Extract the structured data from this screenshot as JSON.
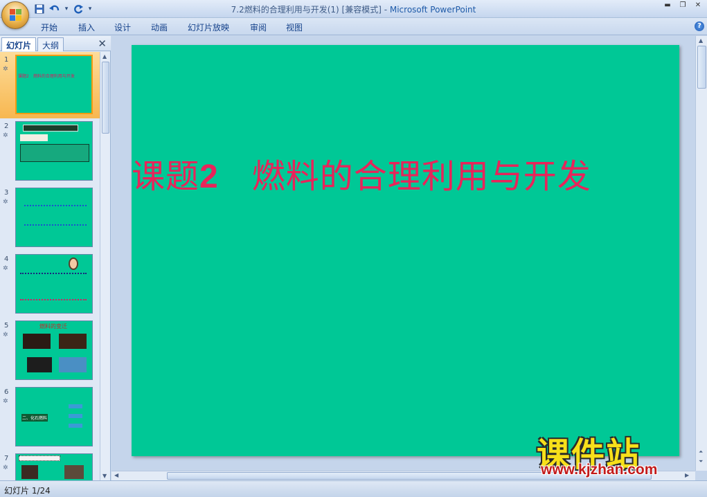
{
  "window": {
    "title": "7.2燃料的合理利用与开发(1) [兼容模式] - ",
    "app_name": "Microsoft PowerPoint"
  },
  "ribbon": {
    "tabs": [
      "开始",
      "插入",
      "设计",
      "动画",
      "幻灯片放映",
      "审阅",
      "视图"
    ]
  },
  "left_pane": {
    "tabs": [
      "幻灯片",
      "大纲"
    ],
    "close_glyph": "✕",
    "thumbnails": [
      {
        "number": "1",
        "text": "课题2　燃料的合理利用与开发",
        "selected": true
      },
      {
        "number": "2",
        "text": "",
        "selected": false
      },
      {
        "number": "3",
        "text": "",
        "selected": false
      },
      {
        "number": "4",
        "text": "",
        "selected": false
      },
      {
        "number": "5",
        "text": "燃料的变迁",
        "selected": false
      },
      {
        "number": "6",
        "text": "二、化石燃料",
        "selected": false
      },
      {
        "number": "7",
        "text": "",
        "selected": false
      }
    ]
  },
  "slide": {
    "title_prefix": "课题",
    "title_number": "2",
    "title_rest": "燃料的合理利用与开发",
    "background_color": "#00c896",
    "title_color": "#e8245a"
  },
  "watermark": {
    "main": "课件站",
    "url": "www.kjzhan.com"
  },
  "status": {
    "slide_indicator": "幻灯片 1/24"
  },
  "icons": {
    "office_button": "office-logo-icon",
    "save": "save-icon",
    "undo": "undo-icon",
    "redo": "redo-icon",
    "help": "help-icon"
  }
}
